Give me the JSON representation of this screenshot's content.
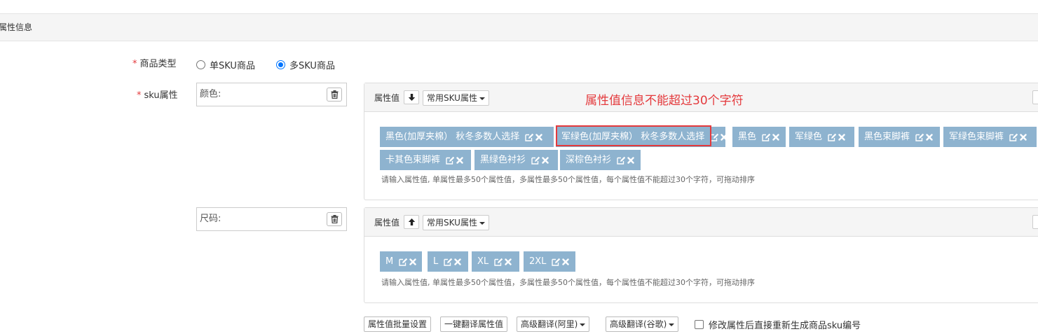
{
  "section": {
    "title": "属性信息"
  },
  "product_type": {
    "label": "商品类型",
    "required_mark": "*",
    "options": [
      {
        "label": "单SKU商品",
        "checked": false
      },
      {
        "label": "多SKU商品",
        "checked": true
      }
    ]
  },
  "sku": {
    "label": "sku属性",
    "required_mark": "*",
    "attributes": [
      {
        "name": "颜色:",
        "header_label": "属性值",
        "sort_direction": "down",
        "dropdown_label": "常用SKU属性",
        "values": [
          "黑色(加厚夹棉） 秋冬多数人选择",
          "军绿色(加厚夹棉） 秋冬多数人选择",
          "黑色",
          "军绿色",
          "黑色束脚裤",
          "军绿色束脚裤",
          "卡其色束脚裤",
          "黑绿色衬衫",
          "深棕色衬衫"
        ],
        "hint": "请输入属性值, 单属性最多50个属性值，多属性最多50个属性值，每个属性值不能超过30个字符，可拖动排序"
      },
      {
        "name": "尺码:",
        "header_label": "属性值",
        "sort_direction": "up",
        "dropdown_label": "常用SKU属性",
        "values": [
          "M",
          "L",
          "XL",
          "2XL"
        ],
        "hint": "请输入属性值, 单属性最多50个属性值，多属性最多50个属性值，每个属性值不能超过30个字符，可拖动排序"
      }
    ]
  },
  "annotation": {
    "warning": "属性值信息不能超过30个字符"
  },
  "bottom": {
    "batch_label": "属性值批量设置",
    "translate_label": "一键翻译属性值",
    "ali_label": "高级翻译(阿里)",
    "google_label": "高级翻译(谷歌)",
    "regen_label": "修改属性后直接重新生成商品sku编号"
  },
  "colors": {
    "tag_bg": "#8eb3cf",
    "warning": "#e4393c",
    "radio_accent": "#0075ff"
  },
  "icons": {
    "delete": "trash-icon",
    "edit": "edit-icon",
    "remove": "close-icon",
    "sort_down": "arrow-down-icon",
    "sort_up": "arrow-up-icon",
    "caret": "caret-down-icon"
  }
}
